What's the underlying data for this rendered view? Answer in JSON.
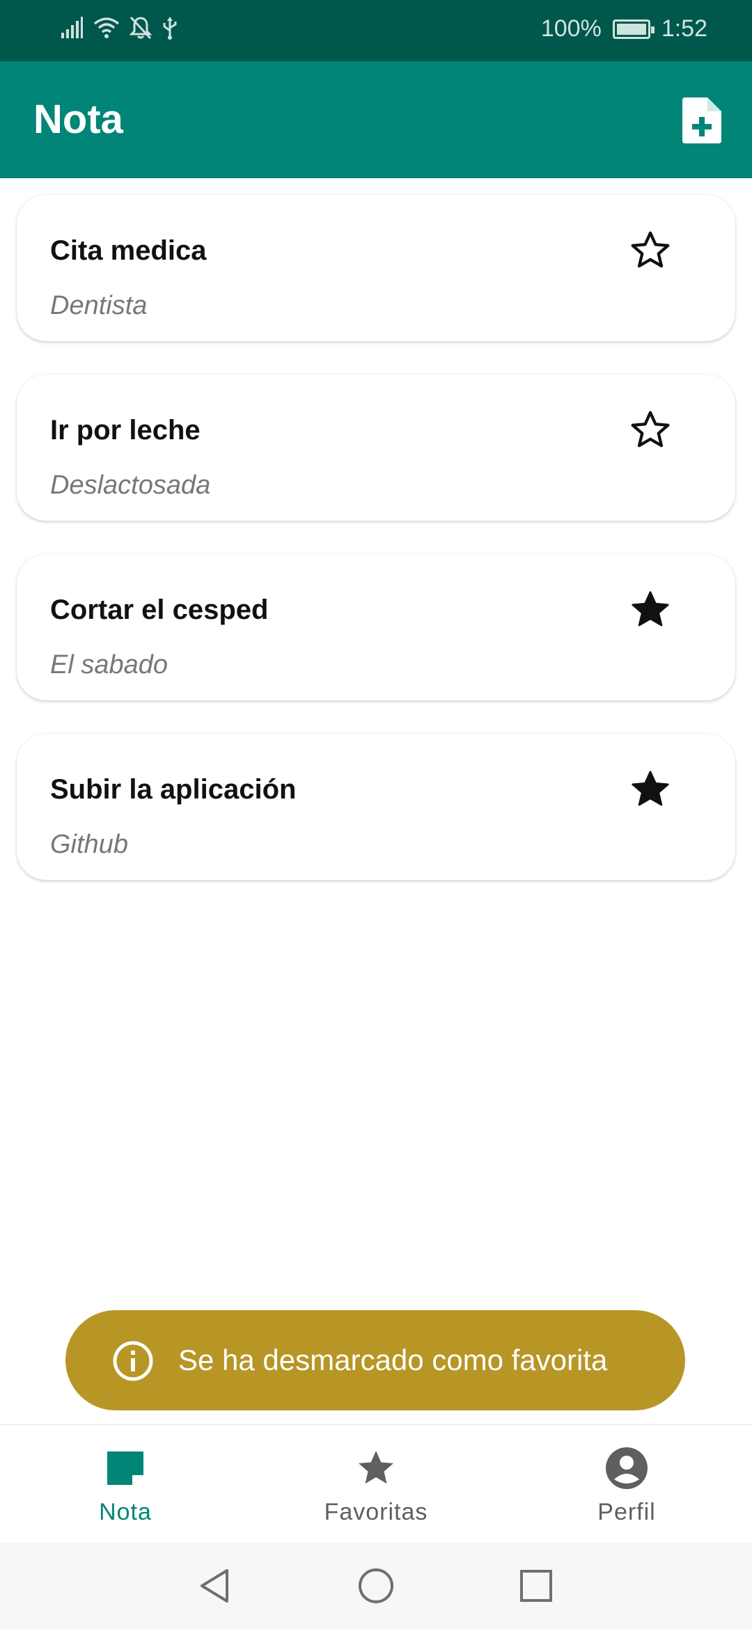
{
  "status_bar": {
    "battery": "100%",
    "time": "1:52",
    "icons": [
      "signal-icon",
      "wifi-icon",
      "bell-off-icon",
      "usb-icon",
      "battery-icon"
    ]
  },
  "app_bar": {
    "title": "Nota",
    "action_icon": "add-note-icon"
  },
  "notes": [
    {
      "title": "Cita medica",
      "subtitle": "Dentista",
      "favorite": false
    },
    {
      "title": "Ir por leche",
      "subtitle": "Deslactosada",
      "favorite": false
    },
    {
      "title": "Cortar el cesped",
      "subtitle": "El sabado",
      "favorite": true
    },
    {
      "title": "Subir la aplicación",
      "subtitle": "Github",
      "favorite": true
    }
  ],
  "snackbar": {
    "icon": "info-icon",
    "text": "Se ha desmarcado como favorita",
    "color": "#b89626"
  },
  "bottom_nav": {
    "items": [
      {
        "label": "Nota",
        "icon": "note-icon",
        "active": true
      },
      {
        "label": "Favoritas",
        "icon": "star-icon",
        "active": false
      },
      {
        "label": "Perfil",
        "icon": "account-icon",
        "active": false
      }
    ]
  },
  "colors": {
    "primary": "#018577",
    "primary_dark": "#00574b",
    "snackbar": "#b89626"
  }
}
